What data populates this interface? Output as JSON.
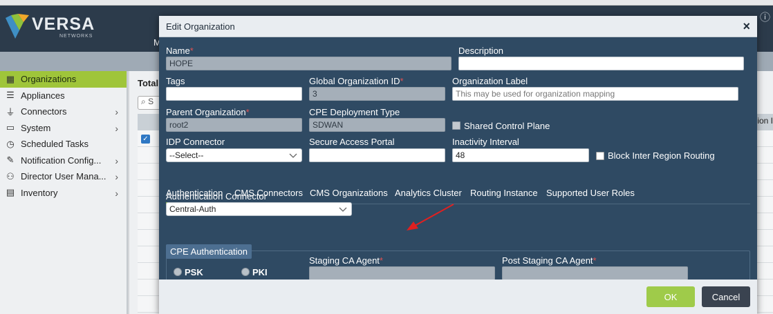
{
  "app": {
    "logo_text": "VERSA",
    "logo_sub": "NETWORKS",
    "nav_glimpse": "M",
    "total_glimpse": "Total",
    "search_glimpse": "S",
    "right_glimpse": "ion I"
  },
  "sidebar": {
    "items": [
      {
        "label": "Organizations",
        "icon": "organizations-icon",
        "active": true
      },
      {
        "label": "Appliances",
        "icon": "appliances-icon"
      },
      {
        "label": "Connectors",
        "icon": "connectors-icon",
        "chevron": true
      },
      {
        "label": "System",
        "icon": "system-icon",
        "chevron": true
      },
      {
        "label": "Scheduled Tasks",
        "icon": "scheduled-tasks-icon"
      },
      {
        "label": "Notification Config...",
        "icon": "notification-icon",
        "chevron": true
      },
      {
        "label": "Director User Mana...",
        "icon": "users-icon",
        "chevron": true
      },
      {
        "label": "Inventory",
        "icon": "inventory-icon",
        "chevron": true
      }
    ]
  },
  "modal": {
    "title": "Edit Organization",
    "close_glyph": "×",
    "fields": {
      "name_label": "Name",
      "name_value": "HOPE",
      "description_label": "Description",
      "description_value": "",
      "tags_label": "Tags",
      "tags_value": "",
      "global_org_id_label": "Global Organization ID",
      "global_org_id_value": "3",
      "org_label_label": "Organization Label",
      "org_label_placeholder": "This may be used for organization mapping",
      "parent_org_label": "Parent Organization",
      "parent_org_value": "root2",
      "cpe_deploy_label": "CPE Deployment Type",
      "cpe_deploy_value": "SDWAN",
      "shared_cp_label": "Shared Control Plane",
      "idp_label": "IDP Connector",
      "idp_value": "--Select--",
      "sap_label": "Secure Access Portal",
      "sap_value": "",
      "inactivity_label": "Inactivity Interval",
      "inactivity_value": "48",
      "block_irr_label": "Block Inter Region Routing",
      "required_mark": "*"
    },
    "tabs": [
      {
        "label": "Authentication",
        "active": true
      },
      {
        "label": "CMS Connectors"
      },
      {
        "label": "CMS Organizations"
      },
      {
        "label": "Analytics Cluster"
      },
      {
        "label": "Routing Instance"
      },
      {
        "label": "Supported User Roles"
      }
    ],
    "auth": {
      "connector_label": "Authentication Connector",
      "connector_value": "Central-Auth",
      "cpe_auth_legend": "CPE Authentication",
      "psk_label": "PSK",
      "pki_label": "PKI",
      "staging_label": "Staging CA Agent",
      "post_staging_label": "Post Staging CA Agent"
    },
    "buttons": {
      "ok": "OK",
      "cancel": "Cancel"
    },
    "annotation_color": "#e02020"
  }
}
